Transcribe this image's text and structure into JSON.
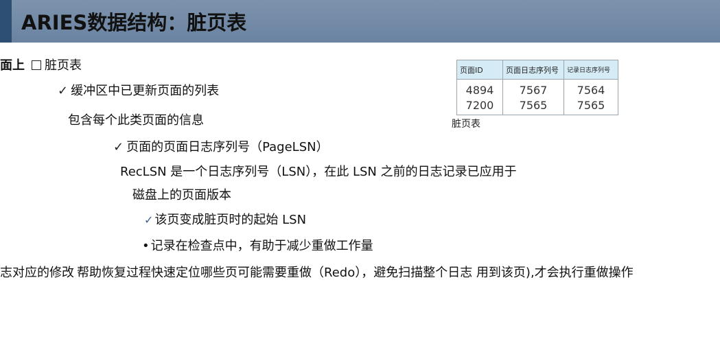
{
  "header": {
    "title": "ARIES数据结构：脏页表"
  },
  "content": {
    "intro_prefix": "面上",
    "intro_label": "脏页表",
    "line_buffer_list": "缓冲区中已更新页面的列表",
    "line_contains": "包含每个此类页面的信息",
    "line_pagelsn": "页面的页面日志序列号（PageLSN）",
    "line_reclsn_1": "RecLSN 是一个日志序列号（LSN），在此 LSN 之前的日志记录已应用于",
    "line_reclsn_2": "磁盘上的页面版本",
    "line_dirty_start": "该页变成脏页时的起始 LSN",
    "line_checkpoint": "记录在检查点中，有助于减少重做工作量",
    "line_bottom_a": "志对应的修改",
    "line_bottom_b": "帮助恢复过程快速定位哪些页可能需要重做（Redo），避免扫描整个日志 用到该页),才会执行重做操作"
  },
  "table": {
    "headers": [
      "页面ID",
      "页面日志序列号",
      "记录日志序列号"
    ],
    "rows": [
      [
        "4894",
        "7567",
        "7564"
      ],
      [
        "7200",
        "7565",
        "7565"
      ]
    ],
    "caption": "脏页表"
  },
  "colors": {
    "header_bg": "#6a83a1",
    "header_accent": "#2e4f74",
    "table_header_bg": "#d5ecf7"
  }
}
